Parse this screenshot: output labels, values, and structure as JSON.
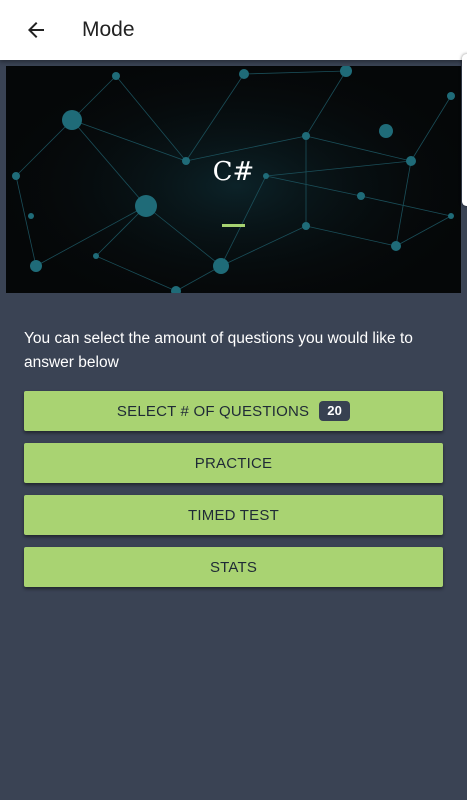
{
  "app_bar": {
    "back_icon": "arrow-left-icon",
    "title": "Mode"
  },
  "hero": {
    "title": "C#",
    "accent_color": "#a6d271"
  },
  "instructions": "You can select the amount of questions you would like to answer below",
  "buttons": {
    "select_questions": {
      "label": "SELECT # OF QUESTIONS",
      "badge": "20"
    },
    "practice": "PRACTICE",
    "timed_test": "TIMED TEST",
    "stats": "STATS"
  },
  "colors": {
    "background": "#3a4354",
    "button": "#a9d372",
    "app_bar": "#ffffff"
  }
}
